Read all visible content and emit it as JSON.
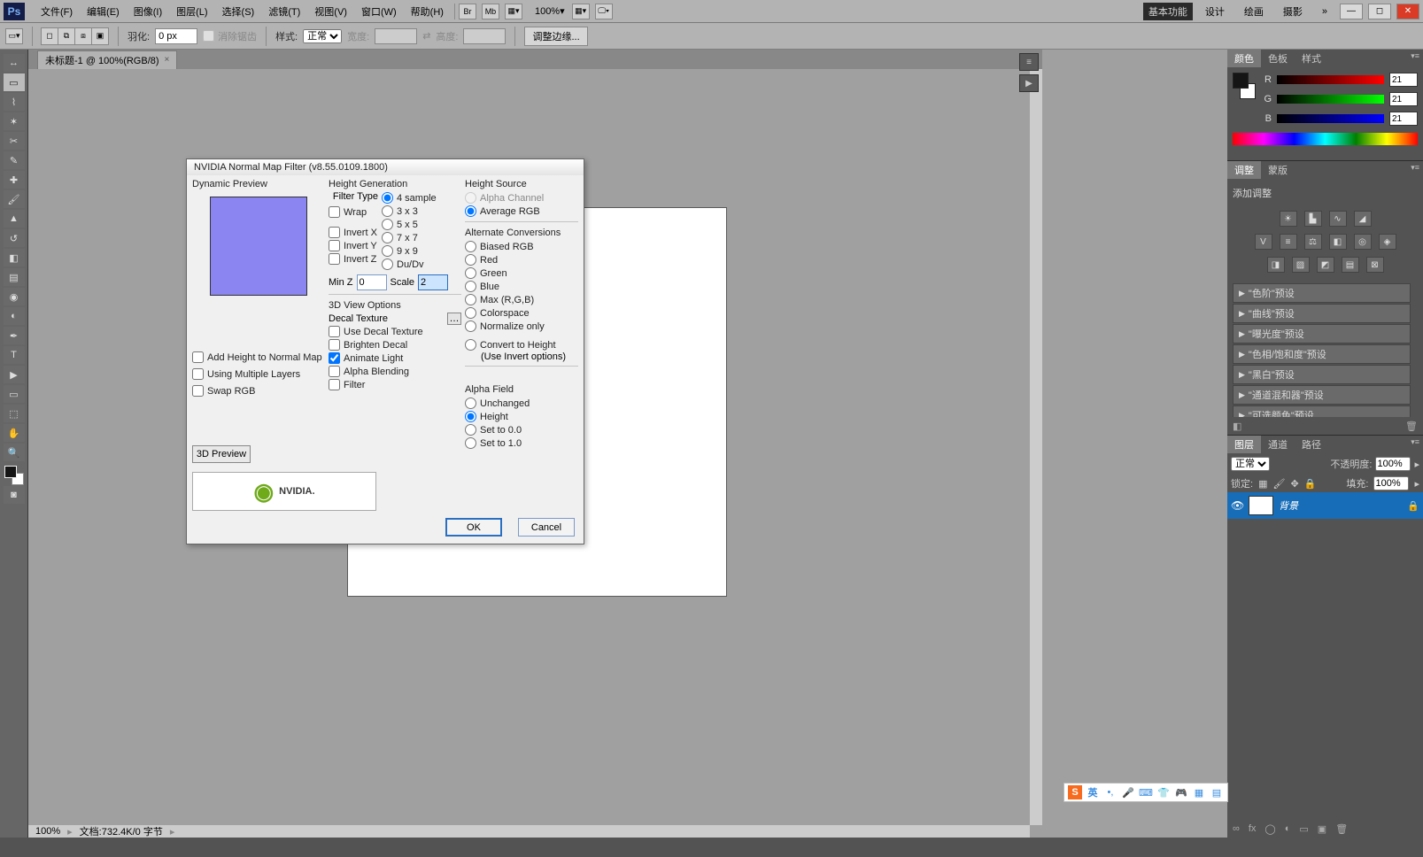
{
  "menu": {
    "items": [
      "文件(F)",
      "编辑(E)",
      "图像(I)",
      "图层(L)",
      "选择(S)",
      "滤镜(T)",
      "视图(V)",
      "窗口(W)",
      "帮助(H)"
    ],
    "zoom_select": "100%",
    "workspace": {
      "essentials": "基本功能",
      "design": "设计",
      "painting": "绘画",
      "photography": "摄影"
    }
  },
  "options": {
    "feather_label": "羽化:",
    "feather_value": "0 px",
    "anti_alias": "消除锯齿",
    "style_label": "样式:",
    "style_value": "正常",
    "width_label": "宽度:",
    "height_label": "高度:",
    "refine_edge": "调整边缘..."
  },
  "doc_tab": {
    "title": "未标题-1 @ 100%(RGB/8)"
  },
  "doc_status": {
    "zoom": "100%",
    "info": "文档:732.4K/0 字节"
  },
  "color_panel": {
    "tabs": [
      "颜色",
      "色板",
      "样式"
    ],
    "R": "21",
    "G": "21",
    "B": "21"
  },
  "adjust_panel": {
    "tabs": [
      "调整",
      "蒙版"
    ],
    "title": "添加调整",
    "presets": [
      "\"色阶\"预设",
      "\"曲线\"预设",
      "\"曝光度\"预设",
      "\"色相/饱和度\"预设",
      "\"黑白\"预设",
      "\"通道混和器\"预设",
      "\"可选颜色\"预设"
    ]
  },
  "layers_panel": {
    "tabs": [
      "图层",
      "通道",
      "路径"
    ],
    "blend_mode": "正常",
    "opacity_label": "不透明度:",
    "opacity": "100%",
    "lock_label": "锁定:",
    "fill_label": "填充:",
    "fill": "100%",
    "layer_name": "背景"
  },
  "dialog": {
    "title": "NVIDIA Normal Map Filter (v8.55.0109.1800)",
    "dynamic_preview": "Dynamic Preview",
    "add_height": "Add Height to Normal Map",
    "using_multiple": "Using Multiple Layers",
    "swap_rgb": "Swap RGB",
    "btn_3d": "3D Preview",
    "height_gen": "Height Generation",
    "filter_type": "Filter Type",
    "ft": {
      "s4": "4 sample",
      "x3": "3 x 3",
      "x5": "5 x 5",
      "x7": "7 x 7",
      "x9": "9 x 9",
      "dudv": "Du/Dv"
    },
    "wrap": "Wrap",
    "invx": "Invert X",
    "invy": "Invert Y",
    "invz": "Invert Z",
    "minz_label": "Min Z",
    "minz": "0",
    "scale_label": "Scale",
    "scale": "2",
    "view3d": "3D View Options",
    "decal_texture": "Decal Texture",
    "use_decal": "Use Decal Texture",
    "brighten": "Brighten Decal",
    "animate": "Animate Light",
    "alpha_blend": "Alpha Blending",
    "filter": "Filter",
    "height_source": "Height Source",
    "hs": {
      "alpha": "Alpha Channel",
      "avg": "Average RGB"
    },
    "alt_conv": "Alternate Conversions",
    "ac": {
      "biased": "Biased RGB",
      "red": "Red",
      "green": "Green",
      "blue": "Blue",
      "max": "Max (R,G,B)",
      "cs": "Colorspace",
      "norm": "Normalize only",
      "convert": "Convert to Height",
      "use_inv": "(Use Invert options)"
    },
    "alpha_field": "Alpha Field",
    "af": {
      "unchanged": "Unchanged",
      "height": "Height",
      "set0": "Set to 0.0",
      "set1": "Set to 1.0"
    },
    "ok": "OK",
    "cancel": "Cancel",
    "nvidia": "NVIDIA."
  },
  "ime": {
    "lang": "英"
  }
}
